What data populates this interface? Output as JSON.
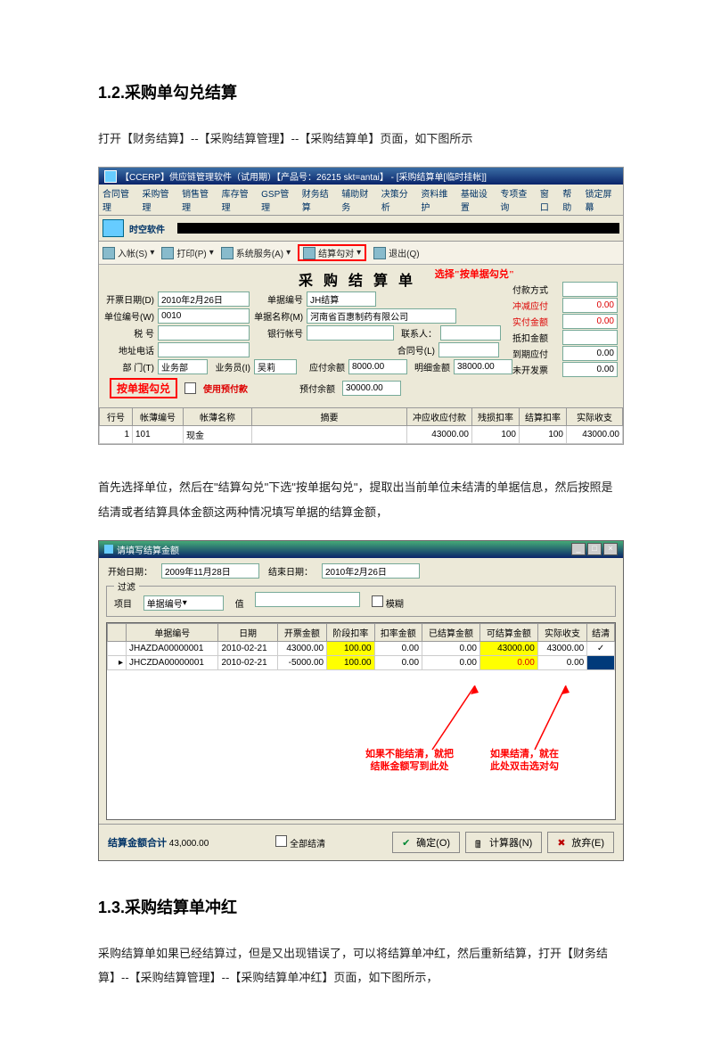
{
  "h1_2": "1.2.采购单勾兑结算",
  "p1": "打开【财务结算】--【采购结算管理】--【采购结算单】页面，如下图所示",
  "shot1": {
    "title": "【CCERP】供应链管理软件（试用期）【产品号：26215  skt=antai】 - [采购结算单[临时挂帐]]",
    "menu": [
      "合同管理",
      "采购管理",
      "销售管理",
      "库存管理",
      "GSP管理",
      "财务结算",
      "辅助财务",
      "决策分析",
      "资料维护",
      "基础设置",
      "专项查询",
      "窗口",
      "帮助",
      "锁定屏幕"
    ],
    "brand": "时空软件",
    "toolbar": {
      "ruk": "入帐(S)",
      "print": "打印(P)",
      "sys": "系统服务(A)",
      "kd": "结算勾对",
      "exit": "退出(Q)"
    },
    "ann_select": "选择\"按单据勾兑\"",
    "form": {
      "title": "采购结算单",
      "date_lbl": "开票日期(D)",
      "date": "2010年2月26日",
      "dwbh_lbl": "单位编号(W)",
      "dwbh": "0010",
      "sh_lbl": "税    号",
      "dztel_lbl": "地址电话",
      "bm_lbl": "部  门(T)",
      "bm": "业务部",
      "ywy_lbl": "业务员(I)",
      "ywy": "吴莉",
      "djbh_lbl": "单据编号",
      "djbh": "JH结算",
      "dwmc_lbl": "单据名称(M)",
      "dwmc": "河南省百惠制药有限公司",
      "yhzh_lbl": "银行帐号",
      "lxr_lbl": "联系人：",
      "hth_lbl": "合同号(L)",
      "yfye_lbl": "应付余额",
      "yfye": "8000.00",
      "mxje_lbl": "明细金额",
      "mxje": "38000.00",
      "yfye2_lbl": "预付余额",
      "yfye2": "30000.00",
      "box": "按单据勾兑",
      "yufu": "使用预付款"
    },
    "right": [
      {
        "lab": "付款方式",
        "val": "",
        "black": true
      },
      {
        "lab": "冲减应付",
        "val": "0.00"
      },
      {
        "lab": "实付金额",
        "val": "0.00"
      },
      {
        "lab": "抵扣金额",
        "val": "",
        "black": true
      },
      {
        "lab": "到期应付",
        "val": "0.00",
        "black": true
      },
      {
        "lab": "未开发票",
        "val": "0.00",
        "black": true
      }
    ],
    "tbl": {
      "head": [
        "行号",
        "帐薄编号",
        "帐薄名称",
        "摘要",
        "冲应收应付款",
        "残损扣率",
        "结算扣率",
        "实际收支"
      ],
      "row": [
        "1",
        "101",
        "现金",
        "",
        "43000.00",
        "100",
        "100",
        "43000.00"
      ]
    }
  },
  "p2": "首先选择单位，然后在\"结算勾兑\"下选\"按单据勾兑\"，提取出当前单位未结清的单据信息，然后按照是结清或者结算具体金额这两种情况填写单据的结算金额，",
  "shot2": {
    "title": "请填写结算金额",
    "start_lbl": "开始日期：",
    "start": "2009年11月28日",
    "end_lbl": "结束日期：",
    "end": "2010年2月26日",
    "filter_legend": "过滤",
    "xm_lbl": "项目",
    "xm": "单据编号",
    "zhi_lbl": "值",
    "fuzzy": "模糊",
    "head": [
      "单据编号",
      "日期",
      "开票金额",
      "阶段扣率",
      "扣率金额",
      "已结算金额",
      "可结算金额",
      "实际收支",
      "结清"
    ],
    "rows": [
      [
        "JHAZDA00000001",
        "2010-02-21",
        "43000.00",
        "100.00",
        "0.00",
        "0.00",
        "43000.00",
        "43000.00",
        "✓"
      ],
      [
        "JHCZDA00000001",
        "2010-02-21",
        "-5000.00",
        "100.00",
        "0.00",
        "0.00",
        "0.00",
        "0.00",
        ""
      ]
    ],
    "ann1": "如果不能结清，就把\n结账金额写到此处",
    "ann2": "如果结清，就在\n此处双击选对勾",
    "sum_lbl": "结算金额合计",
    "sum": "43,000.00",
    "qbj": "全部结清",
    "ok": "确定(O)",
    "calc": "计算器(N)",
    "cancel": "放弃(E)"
  },
  "h1_3": "1.3.采购结算单冲红",
  "p3": "采购结算单如果已经结算过，但是又出现错误了，可以将结算单冲红，然后重新结算，打开【财务结算】--【采购结算管理】--【采购结算单冲红】页面，如下图所示，"
}
